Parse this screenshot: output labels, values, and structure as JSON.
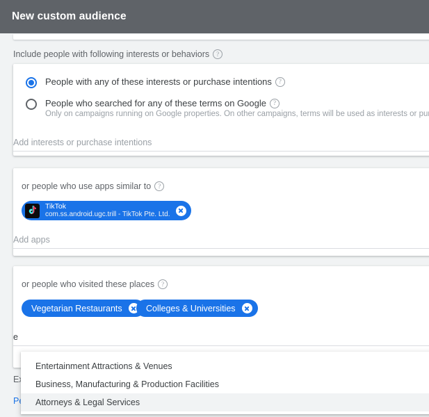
{
  "header": {
    "title": "New custom audience"
  },
  "include_section": {
    "label": "Include people with following interests or behaviors",
    "help_icon": "help-circle-icon",
    "options": [
      {
        "label": "People with any of these interests or purchase intentions",
        "selected": true,
        "help_icon": "help-circle-icon",
        "sub": ""
      },
      {
        "label": "People who searched for any of these terms on Google",
        "selected": false,
        "help_icon": "help-circle-icon",
        "sub": "Only on campaigns running on Google properties. On other campaigns, terms will be used as interests or purchase intentions."
      }
    ],
    "input_placeholder": "Add interests or purchase intentions",
    "input_value": ""
  },
  "apps_section": {
    "label": "or people who use apps similar to",
    "help_icon": "help-circle-icon",
    "chips": [
      {
        "name": "TikTok",
        "package": "com.ss.android.ugc.trill - TikTok Pte. Ltd.",
        "icon": "tiktok-app-icon",
        "remove_icon": "chip-remove-icon"
      }
    ],
    "input_placeholder": "Add apps",
    "input_value": ""
  },
  "places_section": {
    "label": "or people who visited these places",
    "help_icon": "help-circle-icon",
    "chips": [
      {
        "label": "Vegetarian Restaurants",
        "remove_icon": "chip-remove-icon"
      },
      {
        "label": "Colleges & Universities",
        "remove_icon": "chip-remove-icon"
      }
    ],
    "input_placeholder": "",
    "input_value": "e"
  },
  "suggestions": [
    {
      "label": "Entertainment Attractions & Venues",
      "highlighted": false
    },
    {
      "label": "Business, Manufacturing & Production Facilities",
      "highlighted": false
    },
    {
      "label": "Attorneys & Legal Services",
      "highlighted": true
    }
  ],
  "obscured": {
    "exclude_label": "Ex",
    "people_link": "Pe"
  },
  "colors": {
    "header_bg": "#5f6368",
    "accent": "#1a73e8",
    "page_bg": "#f1f3f4",
    "card_bg": "#ffffff",
    "text": "#3c4043",
    "muted": "#9aa0a6",
    "highlight": "#f1f3f4"
  }
}
